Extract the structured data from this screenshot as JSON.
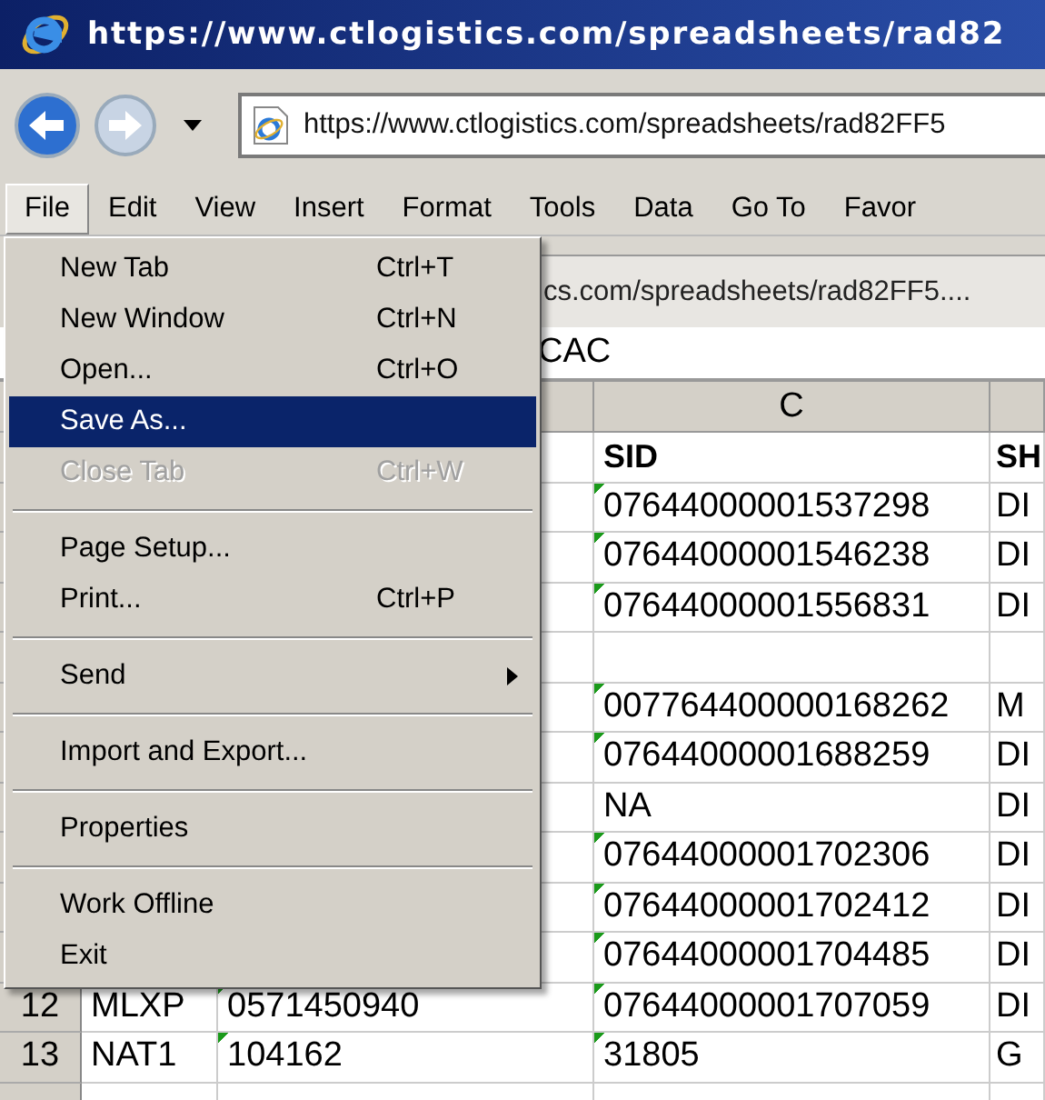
{
  "window": {
    "title": "https://www.ctlogistics.com/spreadsheets/rad82"
  },
  "address_bar": {
    "value": "https://www.ctlogistics.com/spreadsheets/rad82FF5"
  },
  "menu_bar": [
    {
      "label": "File",
      "selected": true
    },
    {
      "label": "Edit",
      "selected": false
    },
    {
      "label": "View",
      "selected": false
    },
    {
      "label": "Insert",
      "selected": false
    },
    {
      "label": "Format",
      "selected": false
    },
    {
      "label": "Tools",
      "selected": false
    },
    {
      "label": "Data",
      "selected": false
    },
    {
      "label": "Go To",
      "selected": false
    },
    {
      "label": "Favor",
      "selected": false
    }
  ],
  "file_menu": [
    {
      "kind": "item",
      "label": "New Tab",
      "shortcut": "Ctrl+T",
      "selected": false,
      "disabled": false
    },
    {
      "kind": "item",
      "label": "New Window",
      "shortcut": "Ctrl+N",
      "selected": false,
      "disabled": false
    },
    {
      "kind": "item",
      "label": "Open...",
      "shortcut": "Ctrl+O",
      "selected": false,
      "disabled": false
    },
    {
      "kind": "item",
      "label": "Save As...",
      "selected": true,
      "disabled": false
    },
    {
      "kind": "item",
      "label": "Close Tab",
      "shortcut": "Ctrl+W",
      "selected": false,
      "disabled": true
    },
    {
      "kind": "separator"
    },
    {
      "kind": "item",
      "label": "Page Setup...",
      "selected": false,
      "disabled": false
    },
    {
      "kind": "item",
      "label": "Print...",
      "shortcut": "Ctrl+P",
      "selected": false,
      "disabled": false
    },
    {
      "kind": "separator"
    },
    {
      "kind": "submenu",
      "label": "Send",
      "selected": false,
      "disabled": false
    },
    {
      "kind": "separator"
    },
    {
      "kind": "item",
      "label": "Import and Export...",
      "selected": false,
      "disabled": false
    },
    {
      "kind": "separator"
    },
    {
      "kind": "item",
      "label": "Properties",
      "selected": false,
      "disabled": false
    },
    {
      "kind": "separator"
    },
    {
      "kind": "item",
      "label": "Work Offline",
      "selected": false,
      "disabled": false
    },
    {
      "kind": "item",
      "label": "Exit",
      "selected": false,
      "disabled": false
    }
  ],
  "tab": {
    "title": "cs.com/spreadsheets/rad82FF5...."
  },
  "formula_bar": {
    "value": "CAC"
  },
  "sheet": {
    "column_header": "C",
    "rows": [
      {
        "c": {
          "text": "SID",
          "flag": false,
          "bold": true
        },
        "d": {
          "text": "SH",
          "flag": false,
          "bold": true
        }
      },
      {
        "c": {
          "text": "07644000001537298",
          "flag": true,
          "bold": false
        },
        "d": {
          "text": "DI",
          "flag": false,
          "bold": false
        }
      },
      {
        "c": {
          "text": "07644000001546238",
          "flag": true,
          "bold": false
        },
        "d": {
          "text": "DI",
          "flag": false,
          "bold": false
        }
      },
      {
        "c": {
          "text": "07644000001556831",
          "flag": true,
          "bold": false
        },
        "d": {
          "text": "DI",
          "flag": false,
          "bold": false
        }
      },
      {},
      {
        "c": {
          "text": "007764400000168262",
          "flag": true,
          "bold": false
        },
        "d": {
          "text": "M",
          "flag": false,
          "bold": false
        }
      },
      {
        "c": {
          "text": "07644000001688259",
          "flag": true,
          "bold": false
        },
        "d": {
          "text": "DI",
          "flag": false,
          "bold": false
        }
      },
      {
        "c": {
          "text": "NA",
          "flag": false,
          "bold": false
        },
        "d": {
          "text": "DI",
          "flag": false,
          "bold": false
        }
      },
      {
        "c": {
          "text": "07644000001702306",
          "flag": true,
          "bold": false
        },
        "d": {
          "text": "DI",
          "flag": false,
          "bold": false
        }
      },
      {
        "c": {
          "text": "07644000001702412",
          "flag": true,
          "bold": false
        },
        "d": {
          "text": "DI",
          "flag": false,
          "bold": false
        }
      },
      {
        "c": {
          "text": "07644000001704485",
          "flag": true,
          "bold": false
        },
        "d": {
          "text": "DI",
          "flag": false,
          "bold": false
        }
      },
      {
        "number": "12",
        "a": {
          "text": "MLXP",
          "flag": false,
          "bold": false
        },
        "b": {
          "text": "0571450940",
          "flag": true,
          "bold": false
        },
        "c": {
          "text": "07644000001707059",
          "flag": true,
          "bold": false
        },
        "d": {
          "text": "DI",
          "flag": false,
          "bold": false
        }
      },
      {
        "number": "13",
        "a": {
          "text": "NAT1",
          "flag": false,
          "bold": false
        },
        "b": {
          "text": "104162",
          "flag": true,
          "bold": false
        },
        "c": {
          "text": "31805",
          "flag": true,
          "bold": false
        },
        "d": {
          "text": "G",
          "flag": false,
          "bold": false
        }
      },
      {}
    ]
  }
}
